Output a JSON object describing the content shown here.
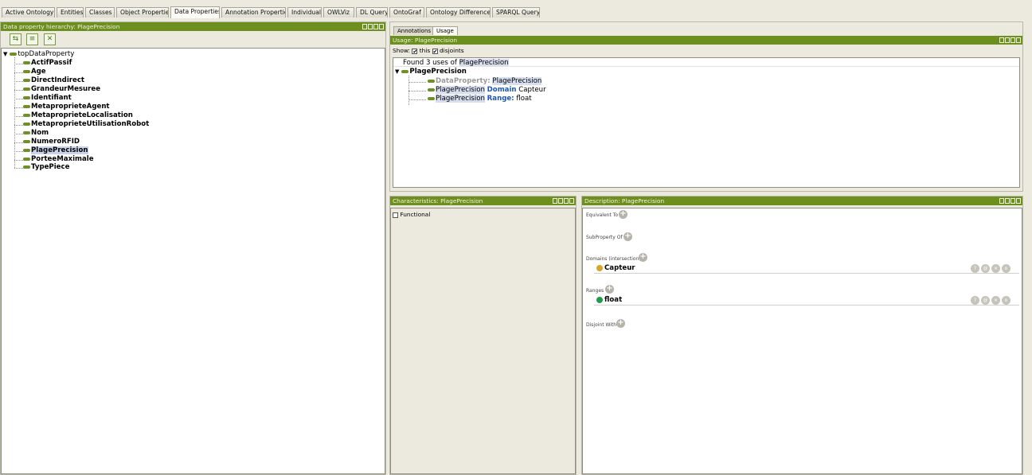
{
  "tabs": [
    {
      "label": "Active Ontology",
      "active": false
    },
    {
      "label": "Entities",
      "active": false
    },
    {
      "label": "Classes",
      "active": false
    },
    {
      "label": "Object Properties",
      "active": false
    },
    {
      "label": "Data Properties",
      "active": true
    },
    {
      "label": "Annotation Properties",
      "active": false
    },
    {
      "label": "Individuals",
      "active": false
    },
    {
      "label": "OWLViz",
      "active": false
    },
    {
      "label": "DL Query",
      "active": false
    },
    {
      "label": "OntoGraf",
      "active": false
    },
    {
      "label": "Ontology Differences",
      "active": false
    },
    {
      "label": "SPARQL Query",
      "active": false
    }
  ],
  "hierarchy": {
    "title": "Data property hierarchy: PlagePrecision",
    "root": "topDataProperty",
    "items": [
      "ActifPassif",
      "Age",
      "DirectIndirect",
      "GrandeurMesuree",
      "Identifiant",
      "MetaproprieteAgent",
      "MetaproprieteLocalisation",
      "MetaproprieteUtilisationRobot",
      "Nom",
      "NumeroRFID",
      "PlagePrecision",
      "PorteeMaximale",
      "TypePiece"
    ],
    "selected": "PlagePrecision"
  },
  "usage": {
    "subtabs": [
      "Annotations",
      "Usage"
    ],
    "active_subtab": "Usage",
    "title": "Usage: PlagePrecision",
    "show_label": "Show:",
    "this_label": "this",
    "disjoints_label": "disjoints",
    "found_prefix": "Found 3 uses of",
    "entity": "PlagePrecision",
    "line1_kw": "DataProperty:",
    "line1_val": "PlagePrecision",
    "line2_subj": "PlagePrecision",
    "line2_kw": "Domain",
    "line2_val": "Capteur",
    "line3_subj": "PlagePrecision",
    "line3_kw": "Range:",
    "line3_val": "float"
  },
  "characteristics": {
    "title": "Characteristics: PlagePrecision",
    "functional_label": "Functional",
    "functional_checked": false
  },
  "description": {
    "title": "Description: PlagePrecision",
    "equivalent_label": "Equivalent To",
    "subproperty_label": "SubProperty Of",
    "domains_label": "Domains (intersection)",
    "domain_value": "Capteur",
    "ranges_label": "Ranges",
    "range_value": "float",
    "disjoint_label": "Disjoint With",
    "row_buttons": [
      "?",
      "@",
      "×",
      "o"
    ]
  },
  "colors": {
    "titlebar": "#6c8f1d",
    "selection": "#c9d4ea",
    "keyword": "#1c58b8",
    "class_dot": "#d6a52a",
    "datatype_dot": "#1f9c4a"
  }
}
